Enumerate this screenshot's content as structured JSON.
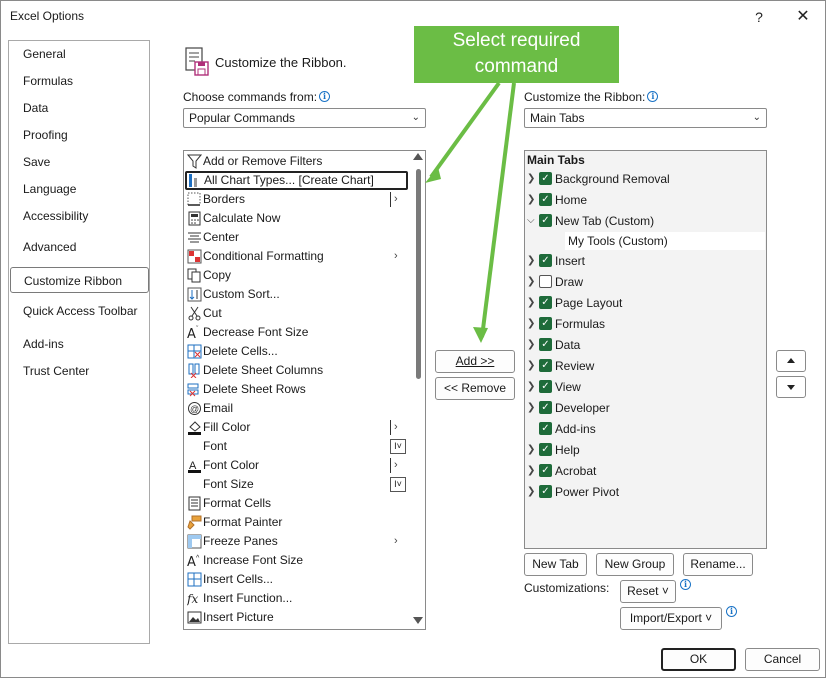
{
  "window": {
    "title": "Excel Options",
    "help_glyph": "?",
    "close_glyph": "✕"
  },
  "nav": {
    "items": [
      {
        "label": "General"
      },
      {
        "label": "Formulas"
      },
      {
        "label": "Data"
      },
      {
        "label": "Proofing"
      },
      {
        "label": "Save"
      },
      {
        "label": "Language"
      },
      {
        "label": "Accessibility"
      },
      {
        "label": "Advanced"
      },
      {
        "label": "Customize Ribbon",
        "selected": true
      },
      {
        "label": "Quick Access Toolbar"
      },
      {
        "label": "Add-ins"
      },
      {
        "label": "Trust Center"
      }
    ]
  },
  "header": {
    "title": "Customize the Ribbon."
  },
  "commands": {
    "label": "Choose commands from:",
    "dropdown_value": "Popular Commands",
    "items": [
      {
        "label": "Add or Remove Filters",
        "icon": "filter-icon"
      },
      {
        "label": "All Chart Types... [Create Chart]",
        "icon": "chart-icon",
        "focused": true
      },
      {
        "label": "Borders",
        "icon": "borders-icon"
      },
      {
        "label": "Calculate Now",
        "icon": "calculator-icon"
      },
      {
        "label": "Center",
        "icon": "align-center-icon"
      },
      {
        "label": "Conditional Formatting",
        "icon": "conditional-formatting-icon"
      },
      {
        "label": "Copy",
        "icon": "copy-icon"
      },
      {
        "label": "Custom Sort...",
        "icon": "sort-icon"
      },
      {
        "label": "Cut",
        "icon": "scissors-icon"
      },
      {
        "label": "Decrease Font Size",
        "icon": "decrease-font-icon"
      },
      {
        "label": "Delete Cells...",
        "icon": "delete-cells-icon"
      },
      {
        "label": "Delete Sheet Columns",
        "icon": "delete-columns-icon"
      },
      {
        "label": "Delete Sheet Rows",
        "icon": "delete-rows-icon"
      },
      {
        "label": "Email",
        "icon": "email-icon"
      },
      {
        "label": "Fill Color",
        "icon": "fill-color-icon"
      },
      {
        "label": "Font",
        "icon": ""
      },
      {
        "label": "Font Color",
        "icon": "font-color-icon"
      },
      {
        "label": "Font Size",
        "icon": ""
      },
      {
        "label": "Format Cells",
        "icon": "format-cells-icon"
      },
      {
        "label": "Format Painter",
        "icon": "format-painter-icon"
      },
      {
        "label": "Freeze Panes",
        "icon": "freeze-panes-icon"
      },
      {
        "label": "Increase Font Size",
        "icon": "increase-font-icon"
      },
      {
        "label": "Insert Cells...",
        "icon": "insert-cells-icon"
      },
      {
        "label": "Insert Function...",
        "icon": "function-icon"
      },
      {
        "label": "Insert Picture",
        "icon": "picture-icon"
      }
    ]
  },
  "ribbon": {
    "label": "Customize the Ribbon:",
    "dropdown_value": "Main Tabs",
    "root": "Main Tabs",
    "tabs": [
      {
        "label": "Background Removal",
        "checked": true
      },
      {
        "label": "Home",
        "checked": true
      },
      {
        "label": "New Tab (Custom)",
        "checked": true,
        "expanded": true
      },
      {
        "label": "Insert",
        "checked": true
      },
      {
        "label": "Draw",
        "checked": false
      },
      {
        "label": "Page Layout",
        "checked": true
      },
      {
        "label": "Formulas",
        "checked": true
      },
      {
        "label": "Data",
        "checked": true
      },
      {
        "label": "Review",
        "checked": true
      },
      {
        "label": "View",
        "checked": true
      },
      {
        "label": "Developer",
        "checked": true
      },
      {
        "label": "Add-ins",
        "checked": true
      },
      {
        "label": "Help",
        "checked": true
      },
      {
        "label": "Acrobat",
        "checked": true
      },
      {
        "label": "Power Pivot",
        "checked": true
      }
    ],
    "sub_group": "My Tools (Custom)"
  },
  "buttons": {
    "add": "Add >>",
    "remove": "<< Remove",
    "new_tab": "New Tab",
    "new_group": "New Group",
    "rename": "Rename...",
    "customizations_label": "Customizations:",
    "reset": "Reset ˅",
    "import_export": "Import/Export ˅",
    "ok": "OK",
    "cancel": "Cancel"
  },
  "callout": {
    "line1": "Select required",
    "line2": "command",
    "color": "#6bbd45"
  }
}
